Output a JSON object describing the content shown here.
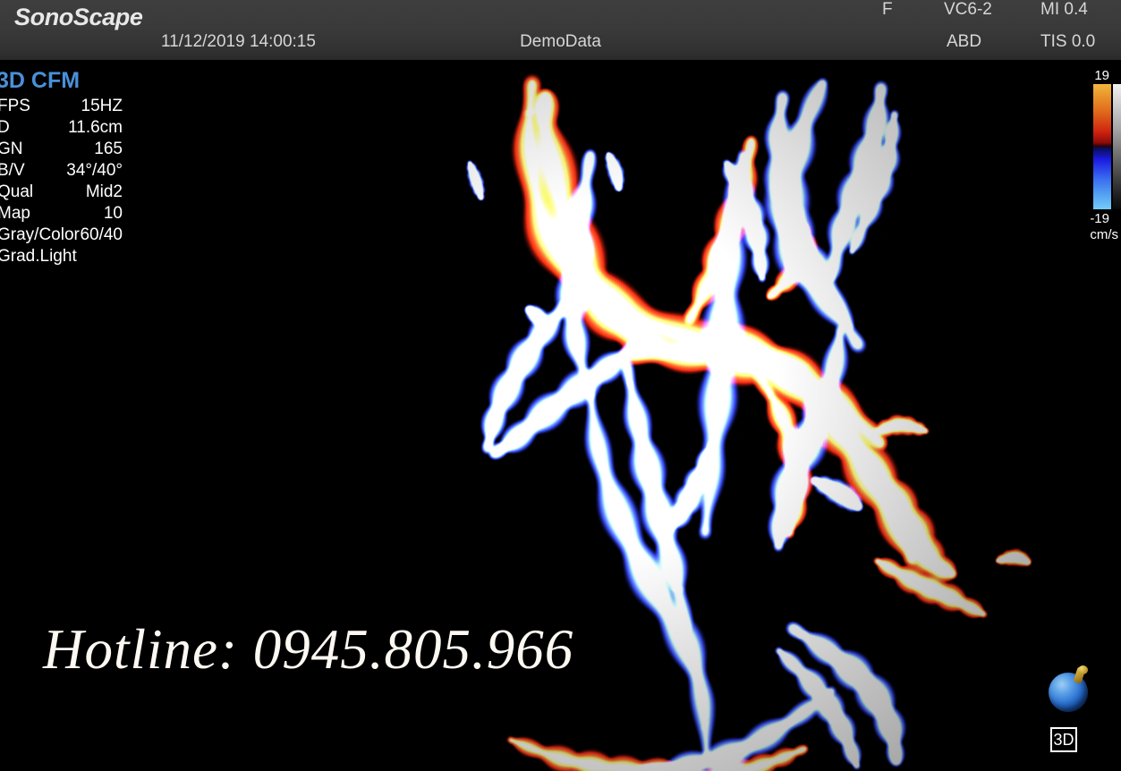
{
  "header": {
    "logo": "SonoScape",
    "datetime": "11/12/2019 14:00:15",
    "patient_name": "DemoData",
    "focus_indicator": "F",
    "probe": "VC6-2",
    "mi": "MI 0.4",
    "preset": "ABD",
    "tis": "TIS 0.0",
    "band_color": "#3a3a3a",
    "text_color": "#d6d6d6"
  },
  "param_panel": {
    "mode_title": "3D CFM",
    "mode_title_color": "#4a90d9",
    "rows": [
      {
        "label": "FPS",
        "value": "15HZ"
      },
      {
        "label": "D",
        "value": "11.6cm"
      },
      {
        "label": "GN",
        "value": "165"
      },
      {
        "label": "B/V",
        "value": "34°/40°"
      },
      {
        "label": "Qual",
        "value": "Mid2"
      },
      {
        "label": "Map",
        "value": "10"
      },
      {
        "label": "Gray/Color",
        "value": "60/40"
      },
      {
        "label": "Grad.Light",
        "value": ""
      }
    ]
  },
  "colorbar": {
    "top_label": "19",
    "bottom_label": "-19",
    "units": "cm/s",
    "positive_color": "#f0b840",
    "mid_positive_color": "#cf2410",
    "negative_color": "#1a1ae0",
    "mid_negative_color": "#76cbfa"
  },
  "orientation_widget": {
    "view_mode_badge": "3D",
    "sphere_color": "#2a6fcf",
    "pin_color": "#c9a233"
  },
  "watermark": {
    "text": "Hotline: 0945.805.966",
    "color": "#fdf8f2"
  },
  "render": {
    "background": "#000000",
    "description": "3D color flow mapping volume render of vascular tree",
    "flow_toward_color": "#ff4422",
    "flow_away_color": "#4466ff"
  }
}
